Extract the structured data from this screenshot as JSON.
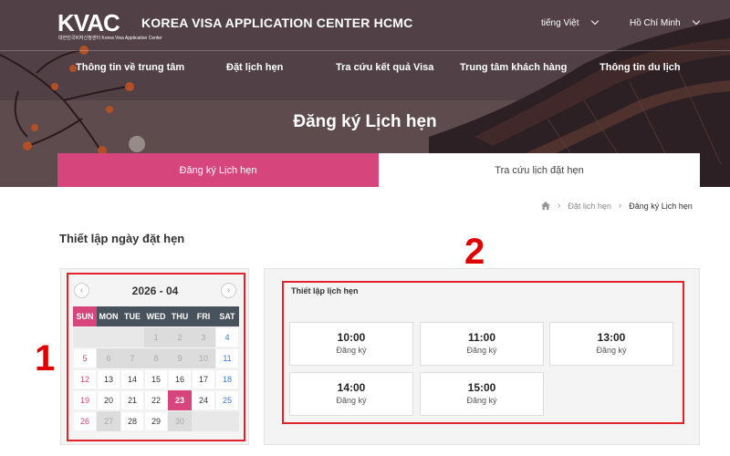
{
  "header": {
    "logo_text": "KVAC",
    "logo_subtitle": "대한민국비자신청센터\nKorea Visa Application Center",
    "site_title": "KOREA VISA APPLICATION CENTER HCMC",
    "language": "tiếng Việt",
    "city": "Hồ Chí Minh"
  },
  "nav": {
    "items": [
      "Thông tin về trung tâm",
      "Đặt lịch hẹn",
      "Tra cứu kết quả Visa",
      "Trung tâm khách hàng",
      "Thông tin du lịch"
    ]
  },
  "hero": {
    "title": "Đăng ký Lịch hẹn"
  },
  "tabs": {
    "active": "Đăng ký Lịch hẹn",
    "inactive": "Tra cứu lịch đặt hẹn"
  },
  "breadcrumb": {
    "items": [
      "Đặt lịch hẹn",
      "Đăng ký Lịch hẹn"
    ]
  },
  "section_title": "Thiết lập ngày đặt hẹn",
  "annotations": {
    "calendar": "1",
    "slots": "2"
  },
  "calendar": {
    "month_label": "2026 - 04",
    "weekdays": [
      "SUN",
      "MON",
      "TUE",
      "WED",
      "THU",
      "FRI",
      "SAT"
    ],
    "weeks": [
      [
        "",
        "",
        "",
        "1",
        "2",
        "3",
        "4"
      ],
      [
        "5",
        "6",
        "7",
        "8",
        "9",
        "10",
        "11"
      ],
      [
        "12",
        "13",
        "14",
        "15",
        "16",
        "17",
        "18"
      ],
      [
        "19",
        "20",
        "21",
        "22",
        "23",
        "24",
        "25"
      ],
      [
        "26",
        "27",
        "28",
        "29",
        "30",
        "",
        ""
      ]
    ],
    "unavailable": [
      "1",
      "2",
      "3",
      "6",
      "7",
      "8",
      "9",
      "10",
      "27",
      "30"
    ],
    "selected": "23",
    "colors": {
      "accent": "#d6457b",
      "header": "#48525c",
      "saturday": "#3a7bd5"
    }
  },
  "slots": {
    "title": "Thiết lập lịch hẹn",
    "items": [
      {
        "time": "10:00",
        "label": "Đăng ký"
      },
      {
        "time": "11:00",
        "label": "Đăng ký"
      },
      {
        "time": "13:00",
        "label": "Đăng ký"
      },
      {
        "time": "14:00",
        "label": "Đăng ký"
      },
      {
        "time": "15:00",
        "label": "Đăng ký"
      }
    ]
  }
}
